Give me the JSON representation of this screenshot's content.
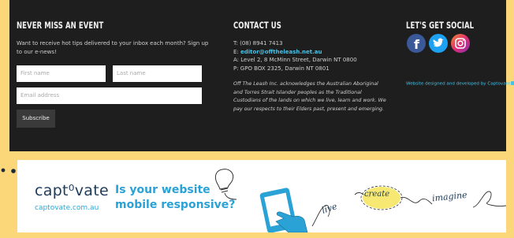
{
  "newsletter": {
    "title": "NEVER MISS AN EVENT",
    "desc_line1": "Want to receive hot tips delivered to your inbox each month? Sign up",
    "desc_line2": "to our e-news!",
    "first_name_placeholder": "First name",
    "last_name_placeholder": "Last name",
    "email_placeholder": "Email address",
    "subscribe_label": "Subscribe"
  },
  "contact": {
    "title": "CONTACT US",
    "phone": "T: (08) 8941 7413",
    "email_prefix": "E: ",
    "email": "editor@offtheleash.net.au",
    "address": "A: Level 2, 8 McMinn Street, Darwin NT 0800",
    "po_box": "P: GPO BOX 2325, Darwin NT 0801",
    "ack_line1": "Off The Leash Inc. acknowledges the Australian Aboriginal",
    "ack_line2": "and Torres Strait Islander peoples as the Traditional",
    "ack_line3": "Custodians of the lands on which we live, learn and work. We",
    "ack_line4": "pay our respects to their Elders past, present and emerging."
  },
  "social": {
    "title": "LET'S GET SOCIAL",
    "icons": [
      "facebook-icon",
      "twitter-icon",
      "instagram-icon"
    ],
    "credit": "Website designed and developed by Captovate"
  },
  "banner": {
    "logo_text": "capt⁰vate",
    "logo_url_text": "captovate.com.au",
    "tagline_line1": "Is your website",
    "tagline_line2": "mobile responsive?",
    "word_live": "live",
    "word_create": "create",
    "word_imagine": "imagine"
  },
  "colors": {
    "background": "#fbd77a",
    "footer": "#1e1e1e",
    "link": "#48c1e6",
    "brand_blue": "#2aa2d6",
    "facebook": "#3b5998",
    "twitter": "#1da1f2"
  }
}
